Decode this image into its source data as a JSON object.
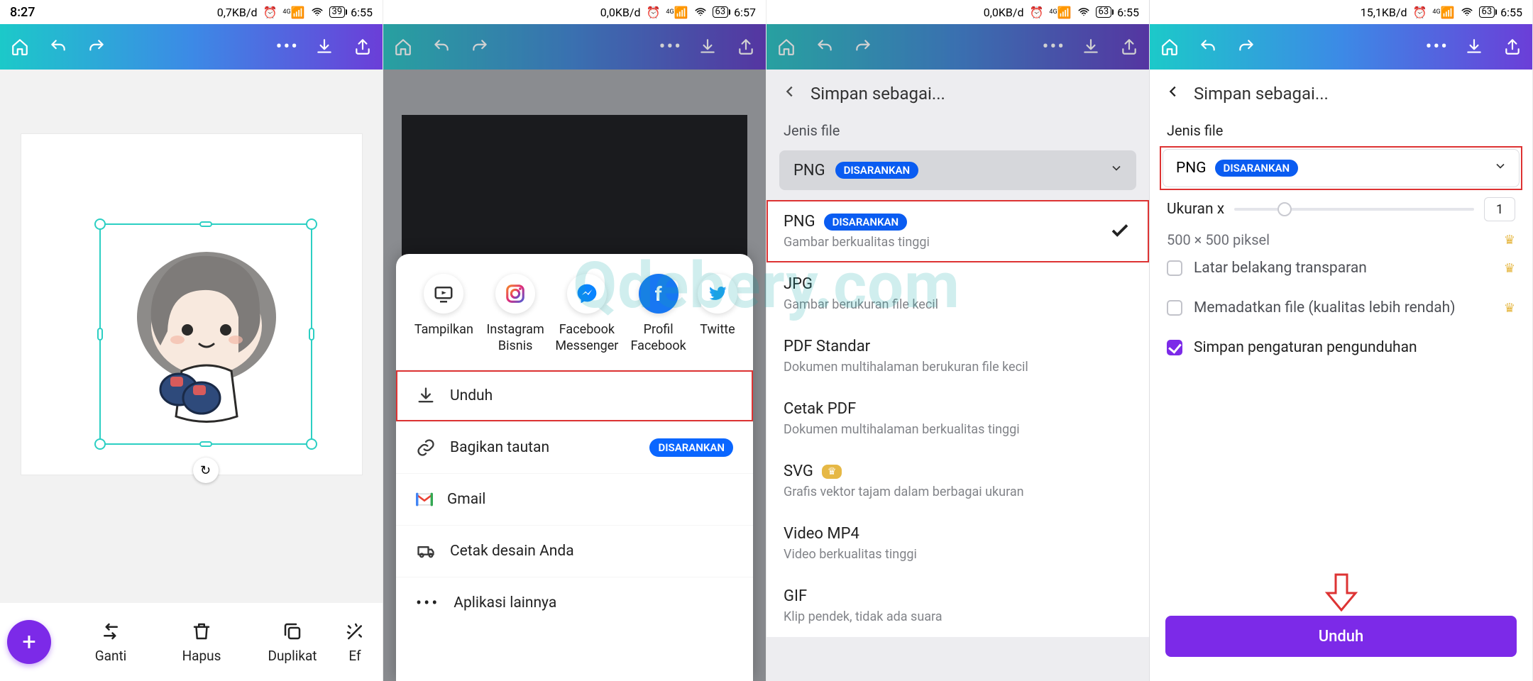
{
  "watermark": "Qdebery.com",
  "status": {
    "p1": {
      "time_left": "8:27",
      "speed": "0,7KB/d",
      "batt": "39",
      "time_right": "6:55"
    },
    "p2": {
      "time_left": "",
      "speed": "0,0KB/d",
      "batt": "63",
      "time_right": "6:57"
    },
    "p3": {
      "time_left": "",
      "speed": "0,0KB/d",
      "batt": "63",
      "time_right": "6:55"
    },
    "p4": {
      "time_left": "",
      "speed": "15,1KB/d",
      "batt": "63",
      "time_right": "6:55"
    }
  },
  "appbar": {
    "home": "⌂",
    "undo": "↶",
    "redo": "↷",
    "more": "•••"
  },
  "p1": {
    "toolbar": {
      "ganti": "Ganti",
      "hapus": "Hapus",
      "duplikat": "Duplikat",
      "efek": "Ef"
    }
  },
  "p2": {
    "share": {
      "items": [
        {
          "label": "Tampilkan"
        },
        {
          "label": "Instagram Bisnis"
        },
        {
          "label": "Facebook Messenger"
        },
        {
          "label": "Profil Facebook"
        },
        {
          "label": "Twitte"
        }
      ]
    },
    "actions": {
      "unduh": "Unduh",
      "bagikan": "Bagikan tautan",
      "disarankan": "DISARANKAN",
      "gmail": "Gmail",
      "cetak": "Cetak desain Anda",
      "lainnya": "Aplikasi lainnya"
    }
  },
  "p3": {
    "header": "Simpan sebagai...",
    "jenis_label": "Jenis file",
    "dd_value": "PNG",
    "dd_badge": "DISARANKAN",
    "types": [
      {
        "title": "PNG",
        "badge": "DISARANKAN",
        "sub": "Gambar berkualitas tinggi",
        "checked": true
      },
      {
        "title": "JPG",
        "sub": "Gambar berukuran file kecil"
      },
      {
        "title": "PDF Standar",
        "sub": "Dokumen multihalaman berukuran file kecil"
      },
      {
        "title": "Cetak PDF",
        "sub": "Dokumen multihalaman berkualitas tinggi"
      },
      {
        "title": "SVG",
        "crown": true,
        "sub": "Grafis vektor tajam dalam berbagai ukuran"
      },
      {
        "title": "Video MP4",
        "sub": "Video berkualitas tinggi"
      },
      {
        "title": "GIF",
        "sub": "Klip pendek, tidak ada suara"
      }
    ]
  },
  "p4": {
    "header": "Simpan sebagai...",
    "jenis_label": "Jenis file",
    "dd_value": "PNG",
    "dd_badge": "DISARANKAN",
    "ukuran_label": "Ukuran x",
    "ukuran_value": "1",
    "dim_text": "500 × 500 piksel",
    "opt_transparent": "Latar belakang transparan",
    "opt_compress": "Memadatkan file (kualitas lebih rendah)",
    "opt_save_pref": "Simpan pengaturan pengunduhan",
    "button": "Unduh"
  }
}
